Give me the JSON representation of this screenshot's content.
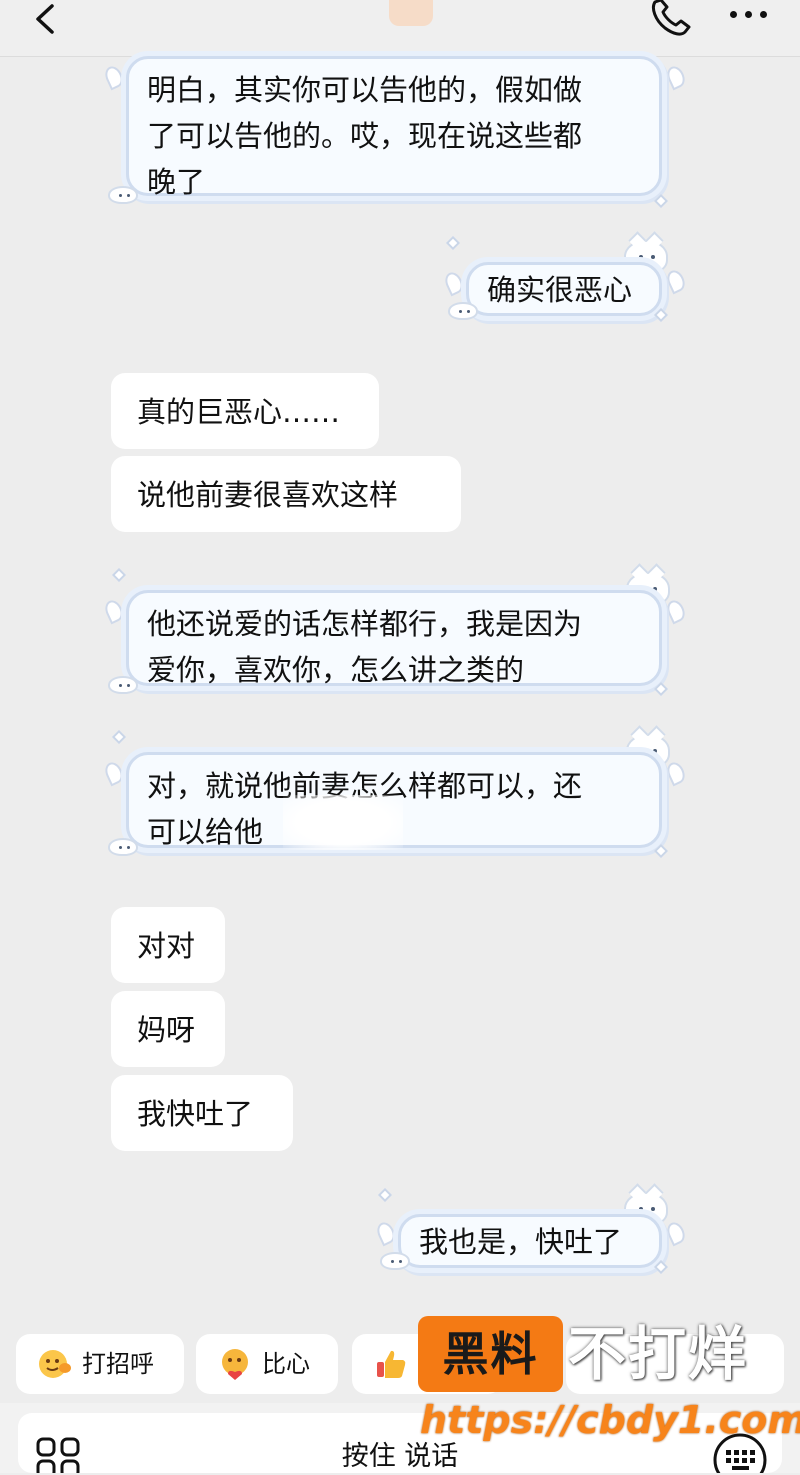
{
  "header": {
    "back_icon": "chevron-left-icon",
    "phone_icon": "phone-icon",
    "more_icon": "more-horizontal-icon"
  },
  "messages": [
    {
      "side": "left",
      "style": "cute",
      "lines": [
        "明白，其实你可以告他的，假如做",
        "了可以告他的。哎，现在说这些都",
        "晚了"
      ]
    },
    {
      "side": "right",
      "style": "cute",
      "lines": [
        "确实很恶心"
      ]
    },
    {
      "side": "left",
      "style": "plain",
      "text": "真的巨恶心……"
    },
    {
      "side": "left",
      "style": "plain",
      "text": "说他前妻很喜欢这样"
    },
    {
      "side": "left",
      "style": "cute",
      "lines": [
        "他还说爱的话怎样都行，我是因为",
        "爱你，喜欢你，怎么讲之类的"
      ]
    },
    {
      "side": "left",
      "style": "cute",
      "lines": [
        "对，就说他前妻怎么样都可以，还",
        "可以给他"
      ]
    },
    {
      "side": "left",
      "style": "plain",
      "text": "对对"
    },
    {
      "side": "left",
      "style": "plain",
      "text": "妈呀"
    },
    {
      "side": "left",
      "style": "plain",
      "text": "我快吐了"
    },
    {
      "side": "right",
      "style": "cute",
      "lines": [
        "我也是，快吐了"
      ]
    }
  ],
  "quick_replies": [
    {
      "label": "打招呼",
      "icon": "wave-emoji-icon"
    },
    {
      "label": "比心",
      "icon": "heart-hands-emoji-icon"
    },
    {
      "label": "",
      "icon": "thumbs-up-emoji-icon"
    }
  ],
  "watermark": {
    "box_text": "黑料",
    "side_text": "不打烊",
    "url": "https://cbdy1.com"
  },
  "input": {
    "voice_label": "按住 说话",
    "apps_icon": "apps-grid-icon",
    "keyboard_icon": "keyboard-icon"
  },
  "colors": {
    "background": "#ededed",
    "bubble": "#ffffff",
    "cute_border": "#cfdcef",
    "watermark_orange": "#f47a14"
  }
}
